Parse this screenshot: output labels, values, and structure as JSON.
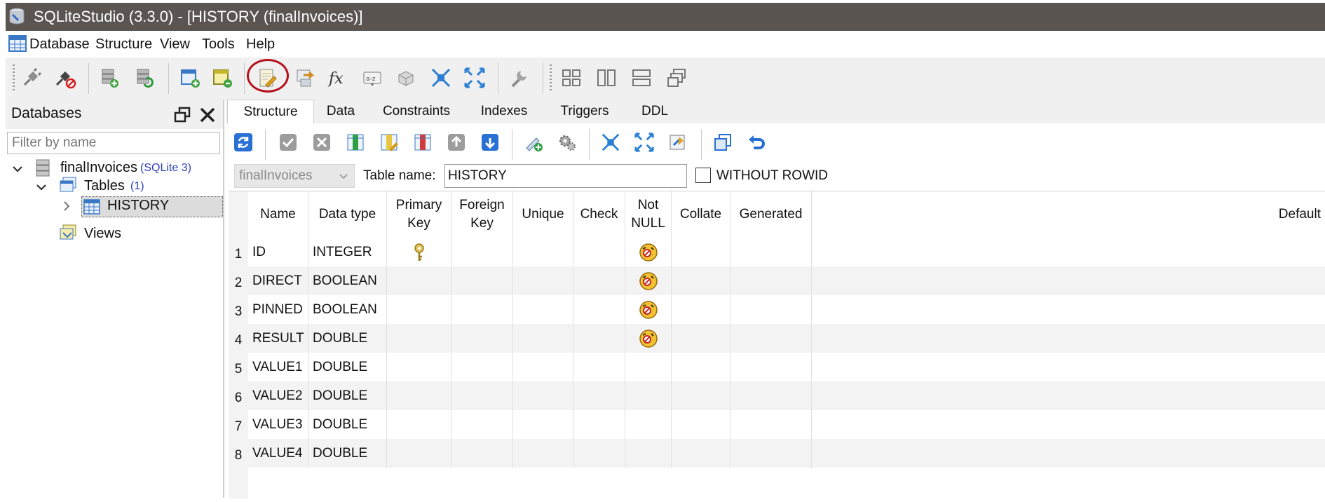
{
  "window": {
    "title": "SQLiteStudio (3.3.0) - [HISTORY (finalInvoices)]"
  },
  "menu": [
    "Database",
    "Structure",
    "View",
    "Tools",
    "Help"
  ],
  "toolbar": {
    "buttons": [
      "connect-icon",
      "disconnect-icon",
      "add-database-icon",
      "edit-database-icon",
      "new-table-icon",
      "edit-table-icon",
      "sql-editor-icon",
      "import-icon",
      "functions-icon",
      "collations-icon",
      "extensions-icon",
      "collapse-icon",
      "expand-icon",
      "config-icon",
      "tile-icon",
      "tile-vertical-icon",
      "tile-horizontal-icon",
      "cascade-icon"
    ],
    "highlighted": "sql-editor-icon"
  },
  "databases_panel": {
    "title": "Databases",
    "filter_placeholder": "Filter by name",
    "tree": {
      "database": "finalInvoices",
      "database_type": "(SQLite 3)",
      "tables_label": "Tables",
      "tables_count": "(1)",
      "table": "HISTORY",
      "views_label": "Views"
    }
  },
  "tabs": [
    "Structure",
    "Data",
    "Constraints",
    "Indexes",
    "Triggers",
    "DDL"
  ],
  "active_tab": "Structure",
  "structure": {
    "database_select": "finalInvoices",
    "table_name_label": "Table name:",
    "table_name": "HISTORY",
    "without_rowid_label": "WITHOUT ROWID",
    "without_rowid_checked": false,
    "columns": [
      "Name",
      "Data type",
      "Primary\nKey",
      "Foreign\nKey",
      "Unique",
      "Check",
      "Not\nNULL",
      "Collate",
      "Generated",
      "Default"
    ],
    "rows": [
      {
        "n": "1",
        "name": "ID",
        "type": "INTEGER",
        "pk": true,
        "notnull": true
      },
      {
        "n": "2",
        "name": "DIRECT",
        "type": "BOOLEAN",
        "pk": false,
        "notnull": true
      },
      {
        "n": "3",
        "name": "PINNED",
        "type": "BOOLEAN",
        "pk": false,
        "notnull": true
      },
      {
        "n": "4",
        "name": "RESULT",
        "type": "DOUBLE",
        "pk": false,
        "notnull": true
      },
      {
        "n": "5",
        "name": "VALUE1",
        "type": "DOUBLE",
        "pk": false,
        "notnull": false
      },
      {
        "n": "6",
        "name": "VALUE2",
        "type": "DOUBLE",
        "pk": false,
        "notnull": false
      },
      {
        "n": "7",
        "name": "VALUE3",
        "type": "DOUBLE",
        "pk": false,
        "notnull": false
      },
      {
        "n": "8",
        "name": "VALUE4",
        "type": "DOUBLE",
        "pk": false,
        "notnull": false
      }
    ]
  },
  "colors": {
    "titlebar": "#5b5551",
    "highlight_circle": "#b3121a",
    "alt_row": "#f3f3f3",
    "accent_blue": "#2b3fbd"
  }
}
